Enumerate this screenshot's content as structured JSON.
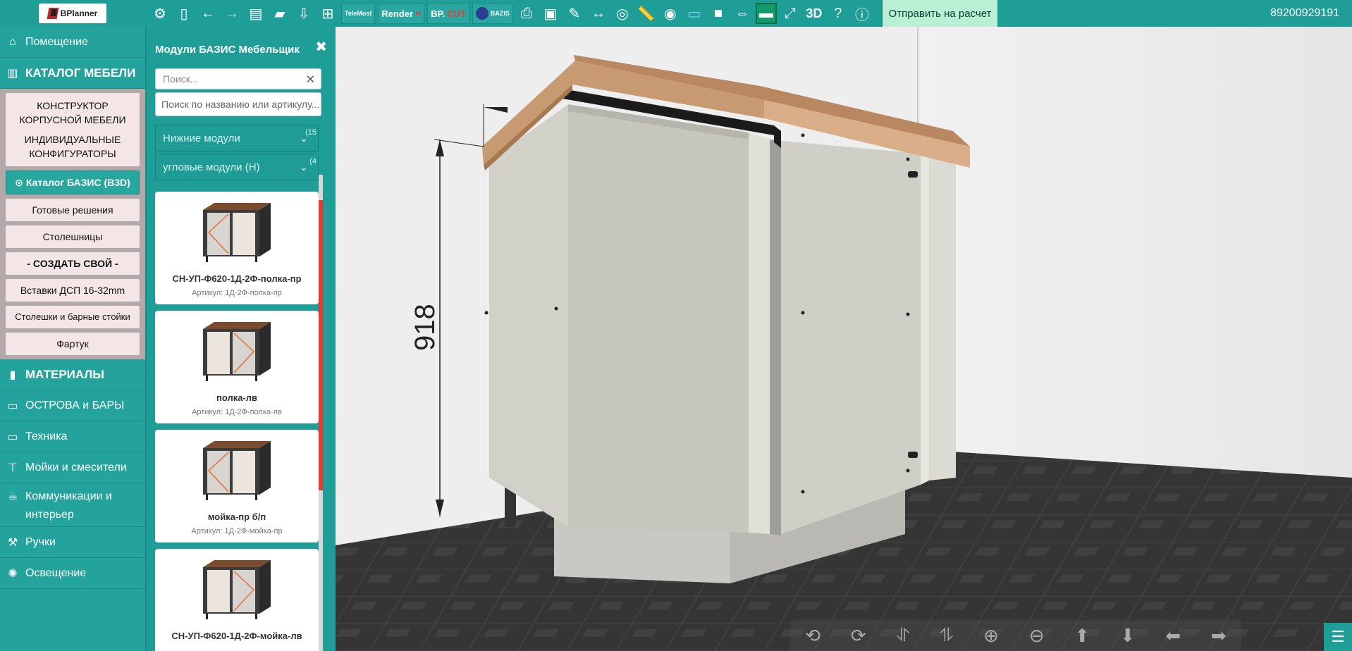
{
  "header": {
    "logo_text": "BPlanner",
    "plugins": {
      "telemost": "TeleMost",
      "render": "Render",
      "render_sup": "AI",
      "cut_prefix": "BP.",
      "cut_suffix": "CUT",
      "bazis": "BAZIS"
    },
    "view_3d_label": "3D",
    "send_button": "Отправить на расчет",
    "phone": "89200929191"
  },
  "sidebar": {
    "room": "Помещение",
    "catalog": "КАТАЛОГ МЕБЕЛИ",
    "sub": {
      "constructor": "КОНСТРУКТОР КОРПУСНОЙ МЕБЕЛИ",
      "configurators": "ИНДИВИДУАЛЬНЫЕ КОНФИГУРАТОРЫ",
      "bazis_catalog": "⊙ Каталог БАЗИС (B3D)",
      "ready": "Готовые решения",
      "tops": "Столешницы",
      "create": "- СОЗДАТЬ СВОЙ -",
      "inserts": "Вставки ДСП 16-32mm",
      "bar": "Столешки и барные стойки",
      "apron": "Фартук"
    },
    "materials": "МАТЕРИАЛЫ",
    "islands": "ОСТРОВА и БАРЫ",
    "appliances": "Техника",
    "sinks": "Мойки и смесители",
    "communications": "Коммуникации и интерьер",
    "handles": "Ручки",
    "lighting": "Освещение"
  },
  "panel": {
    "title": "Модули БАЗИС Мебельщик",
    "search_placeholder": "Поиск...",
    "search2_placeholder": "Поиск по названию или артикулу...",
    "acc1": {
      "label": "Нижние модули",
      "count": "(15"
    },
    "acc2": {
      "label": "угловые модули (Н)",
      "count": "(4"
    },
    "items": [
      {
        "name": "СН-УП-Ф620-1Д-2Ф-полка-пр",
        "article": "Артикул: 1Д-2Ф-полка-пр"
      },
      {
        "name": "полка-лв",
        "article": "Артикул: 1Д-2Ф-полка-лв"
      },
      {
        "name": "мойка-пр б/п",
        "article": "Артикул: 1Д-2Ф-мойка-пр"
      },
      {
        "name": "СН-УП-Ф620-1Д-2Ф-мойка-лв",
        "article": ""
      }
    ]
  },
  "scene": {
    "dimension_label": "918"
  },
  "colors": {
    "primary": "#1f9e97",
    "accent_red": "#e53935",
    "send_bg": "#b9efd5"
  }
}
